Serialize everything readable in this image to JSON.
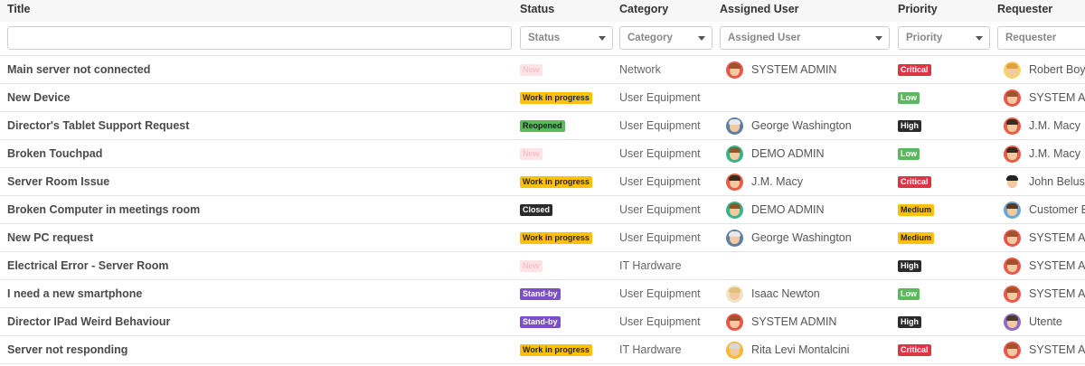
{
  "columns": {
    "title": "Title",
    "status": "Status",
    "category": "Category",
    "assigned_user": "Assigned User",
    "priority": "Priority",
    "requester": "Requester"
  },
  "filters": {
    "status": "Status",
    "category": "Category",
    "assigned_user": "Assigned User",
    "priority": "Priority",
    "requester": "Requester"
  },
  "status_colors": {
    "New": {
      "bg": "#fde2e6",
      "fg": "#f7c3cb"
    },
    "Work in progress": {
      "bg": "#ffc107",
      "fg": "#222222"
    },
    "Reopened": {
      "bg": "#5cb85c",
      "fg": "#1a1a1a"
    },
    "Closed": {
      "bg": "#2b2b2b",
      "fg": "#ffffff"
    },
    "Stand-by": {
      "bg": "#7b4fc9",
      "fg": "#ffffff"
    }
  },
  "priority_colors": {
    "Critical": {
      "bg": "#dc3545",
      "fg": "#ffffff"
    },
    "Low": {
      "bg": "#5cb85c",
      "fg": "#ffffff"
    },
    "High": {
      "bg": "#2b2b2b",
      "fg": "#ffffff"
    },
    "Medium": {
      "bg": "#ffc107",
      "fg": "#222222"
    }
  },
  "avatars": {
    "system": {
      "bg": "#e9574b",
      "hair": "#a0522d"
    },
    "george": {
      "bg": "#5c7fa3",
      "hair": "#e8e8e8"
    },
    "demo": {
      "bg": "#38b48b",
      "hair": "#8b5a2b"
    },
    "jm": {
      "bg": "#e85c45",
      "hair": "#3b2a1e"
    },
    "isaac": {
      "bg": "#f0e4c8",
      "hair": "#e0c07a"
    },
    "rita": {
      "bg": "#f5b82e",
      "hair": "#d8d8d8"
    },
    "robert": {
      "bg": "#f7d36b",
      "hair": "#e0a040"
    },
    "john": {
      "bg": "#ffffff",
      "hair": "#222222"
    },
    "customer": {
      "bg": "#6aa7d8",
      "hair": "#5a3a1e"
    },
    "utente": {
      "bg": "#8e6bc4",
      "hair": "#4a3a2a"
    }
  },
  "rows": [
    {
      "title": "Main server not connected",
      "status": "New",
      "category": "Network",
      "user": "SYSTEM ADMIN",
      "user_avatar": "system",
      "priority": "Critical",
      "requester": "Robert Boyle",
      "requester_avatar": "robert"
    },
    {
      "title": "New Device",
      "status": "Work in progress",
      "category": "User Equipment",
      "user": "",
      "user_avatar": "",
      "priority": "Low",
      "requester": "SYSTEM ADMIN",
      "requester_avatar": "system"
    },
    {
      "title": "Director's Tablet Support Request",
      "status": "Reopened",
      "category": "User Equipment",
      "user": "George Washington",
      "user_avatar": "george",
      "priority": "High",
      "requester": "J.M. Macy",
      "requester_avatar": "jm"
    },
    {
      "title": "Broken Touchpad",
      "status": "New",
      "category": "User Equipment",
      "user": "DEMO ADMIN",
      "user_avatar": "demo",
      "priority": "Low",
      "requester": "J.M. Macy",
      "requester_avatar": "jm"
    },
    {
      "title": "Server Room Issue",
      "status": "Work in progress",
      "category": "User Equipment",
      "user": "J.M. Macy",
      "user_avatar": "jm",
      "priority": "Critical",
      "requester": "John Belushi",
      "requester_avatar": "john"
    },
    {
      "title": "Broken Computer in meetings room",
      "status": "Closed",
      "category": "User Equipment",
      "user": "DEMO ADMIN",
      "user_avatar": "demo",
      "priority": "Medium",
      "requester": "Customer E",
      "requester_avatar": "customer"
    },
    {
      "title": "New PC request",
      "status": "Work in progress",
      "category": "User Equipment",
      "user": "George Washington",
      "user_avatar": "george",
      "priority": "Medium",
      "requester": "SYSTEM ADMIN",
      "requester_avatar": "system"
    },
    {
      "title": "Electrical Error - Server Room",
      "status": "New",
      "category": "IT Hardware",
      "user": "",
      "user_avatar": "",
      "priority": "High",
      "requester": "SYSTEM ADMIN",
      "requester_avatar": "system"
    },
    {
      "title": "I need a new smartphone",
      "status": "Stand-by",
      "category": "User Equipment",
      "user": "Isaac Newton",
      "user_avatar": "isaac",
      "priority": "Low",
      "requester": "SYSTEM ADMIN",
      "requester_avatar": "system"
    },
    {
      "title": "Director IPad Weird Behaviour",
      "status": "Stand-by",
      "category": "User Equipment",
      "user": "SYSTEM ADMIN",
      "user_avatar": "system",
      "priority": "High",
      "requester": "Utente",
      "requester_avatar": "utente"
    },
    {
      "title": "Server not responding",
      "status": "Work in progress",
      "category": "IT Hardware",
      "user": "Rita Levi Montalcini",
      "user_avatar": "rita",
      "priority": "Critical",
      "requester": "SYSTEM ADMIN",
      "requester_avatar": "system"
    }
  ]
}
